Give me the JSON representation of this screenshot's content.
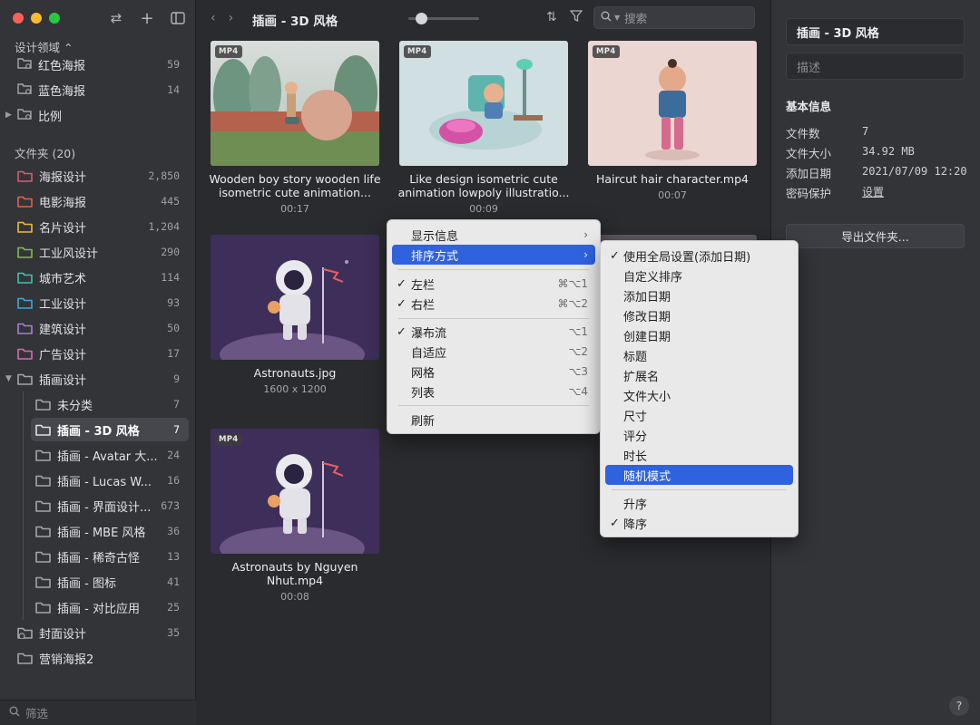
{
  "sidebar": {
    "design_section": "设计领域 ⌃",
    "design_items": [
      {
        "label": "红色海报",
        "count": "59"
      },
      {
        "label": "蓝色海报",
        "count": "14"
      },
      {
        "label": "比例",
        "count": ""
      }
    ],
    "folder_section": "文件夹 (20)",
    "folders": [
      {
        "label": "海报设计",
        "count": "2,850",
        "color": "#e0596a"
      },
      {
        "label": "电影海报",
        "count": "445",
        "color": "#e2604b"
      },
      {
        "label": "名片设计",
        "count": "1,204",
        "color": "#e6bd3a"
      },
      {
        "label": "工业风设计",
        "count": "290",
        "color": "#7bc04c"
      },
      {
        "label": "城市艺术",
        "count": "114",
        "color": "#3fc3a8"
      },
      {
        "label": "工业设计",
        "count": "93",
        "color": "#3fa7d6"
      },
      {
        "label": "建筑设计",
        "count": "50",
        "color": "#b07ad6"
      },
      {
        "label": "广告设计",
        "count": "17",
        "color": "#d46bb4"
      },
      {
        "label": "插画设计",
        "count": "9",
        "color": "#a5a5a8"
      }
    ],
    "subfolders": [
      {
        "label": "未分类",
        "count": "7"
      },
      {
        "label": "插画 - 3D 风格",
        "count": "7"
      },
      {
        "label": "插画 - Avatar 大...",
        "count": "24"
      },
      {
        "label": "插画 - Lucas W...",
        "count": "16"
      },
      {
        "label": "插画 - 界面设计...",
        "count": "673"
      },
      {
        "label": "插画 - MBE 风格",
        "count": "36"
      },
      {
        "label": "插画 - 稀奇古怪",
        "count": "13"
      },
      {
        "label": "插画 - 图标",
        "count": "41"
      },
      {
        "label": "插画 - 对比应用",
        "count": "25"
      }
    ],
    "bottom_folders": [
      {
        "label": "封面设计",
        "count": "35"
      },
      {
        "label": "营销海报2",
        "count": ""
      }
    ],
    "filter_placeholder": "筛选"
  },
  "toolbar": {
    "title": "插画 - 3D 风格",
    "search_placeholder": "搜索",
    "zoom_level": 0.1
  },
  "items": [
    {
      "badge": "MP4",
      "caption": "Wooden boy story wooden life isometric cute animation...",
      "meta": "00:17"
    },
    {
      "badge": "MP4",
      "caption": "Like design isometric cute animation lowpoly illustratio...",
      "meta": "00:09"
    },
    {
      "badge": "MP4",
      "caption": "Haircut hair character.mp4",
      "meta": "00:07"
    },
    {
      "badge": "",
      "caption": "Astronauts.jpg",
      "meta": "1600 x 1200"
    },
    {
      "badge": "MP4",
      "caption": "Astronauts by Nguyen Nhut.mp4",
      "meta": "00:08"
    }
  ],
  "context_menu": {
    "items": [
      {
        "label": "显示信息",
        "submenu": true
      },
      {
        "label": "排序方式",
        "submenu": true,
        "active": true
      },
      {
        "label": "左栏",
        "checked": true,
        "shortcut": "⌘⌥1"
      },
      {
        "label": "右栏",
        "checked": true,
        "shortcut": "⌘⌥2"
      },
      {
        "label": "瀑布流",
        "checked": true,
        "shortcut": "⌥1"
      },
      {
        "label": "自适应",
        "shortcut": "⌥2"
      },
      {
        "label": "网格",
        "shortcut": "⌥3"
      },
      {
        "label": "列表",
        "shortcut": "⌥4"
      },
      {
        "label": "刷新"
      }
    ]
  },
  "sort_menu": {
    "items": [
      {
        "label": "使用全局设置(添加日期)",
        "checked": true
      },
      {
        "label": "自定义排序"
      },
      {
        "label": "添加日期"
      },
      {
        "label": "修改日期"
      },
      {
        "label": "创建日期"
      },
      {
        "label": "标题"
      },
      {
        "label": "扩展名"
      },
      {
        "label": "文件大小"
      },
      {
        "label": "尺寸"
      },
      {
        "label": "评分"
      },
      {
        "label": "时长"
      },
      {
        "label": "随机模式",
        "active": true
      },
      {
        "label": "升序"
      },
      {
        "label": "降序",
        "checked": true
      }
    ]
  },
  "panel": {
    "name": "插画 - 3D 风格",
    "description_placeholder": "描述",
    "basic_info": "基本信息",
    "rows": [
      {
        "label": "文件数",
        "value": "7"
      },
      {
        "label": "文件大小",
        "value": "34.92 MB"
      },
      {
        "label": "添加日期",
        "value": "2021/07/09 12:20"
      },
      {
        "label": "密码保护",
        "value": "设置"
      }
    ],
    "export_label": "导出文件夹...",
    "help": "?"
  },
  "colors": {
    "traffic_red": "#fe5f57",
    "traffic_yellow": "#febb2e",
    "traffic_green": "#28c840",
    "menu_highlight": "#2f62df"
  }
}
